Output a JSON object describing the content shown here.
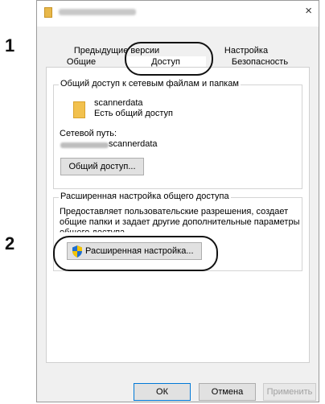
{
  "steps": [
    "1",
    "2"
  ],
  "window": {
    "close_glyph": "×",
    "icon": "folder-icon"
  },
  "tabs": {
    "row1": [
      "Предыдущие версии",
      "Настройка"
    ],
    "row2": [
      "Общие",
      "Доступ",
      "Безопасность"
    ],
    "active": "Доступ"
  },
  "sharing": {
    "group_title": "Общий доступ к сетевым файлам и папкам",
    "folder_name": "scannerdata",
    "folder_status": "Есть общий доступ",
    "net_path_label": "Сетевой путь:",
    "net_path_value": "scannerdata",
    "share_button": "Общий доступ..."
  },
  "advanced": {
    "group_title": "Расширенная настройка общего доступа",
    "description_line1": "Предоставляет пользовательские разрешения, создает",
    "description_line2": "общие папки и задает другие дополнительные параметры",
    "description_line3": "общего доступа.",
    "button": "Расширенная настройка..."
  },
  "footer": {
    "ok": "ОК",
    "cancel": "Отмена",
    "apply": "Применить"
  }
}
